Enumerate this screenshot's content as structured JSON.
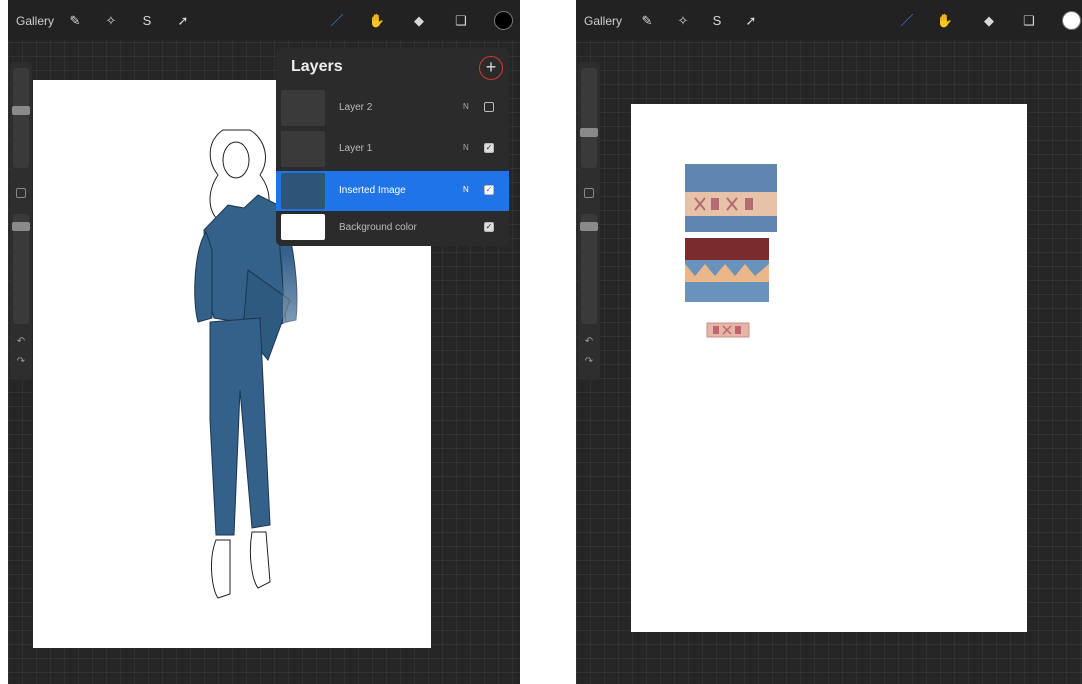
{
  "left": {
    "topbar": {
      "gallery_label": "Gallery"
    },
    "layers": {
      "title": "Layers",
      "add_symbol": "+",
      "rows": [
        {
          "name": "Layer 2",
          "mode": "N",
          "visible": false
        },
        {
          "name": "Layer 1",
          "mode": "N",
          "visible": true
        },
        {
          "name": "Inserted Image",
          "mode": "N",
          "visible": true,
          "selected": true
        },
        {
          "name": "Background color",
          "mode": "",
          "visible": true
        }
      ]
    }
  },
  "right": {
    "topbar": {
      "gallery_label": "Gallery"
    }
  },
  "colors": {
    "suit_blue": "#336189",
    "active_layer": "#1f74e8",
    "add_button_ring": "#d83535"
  }
}
